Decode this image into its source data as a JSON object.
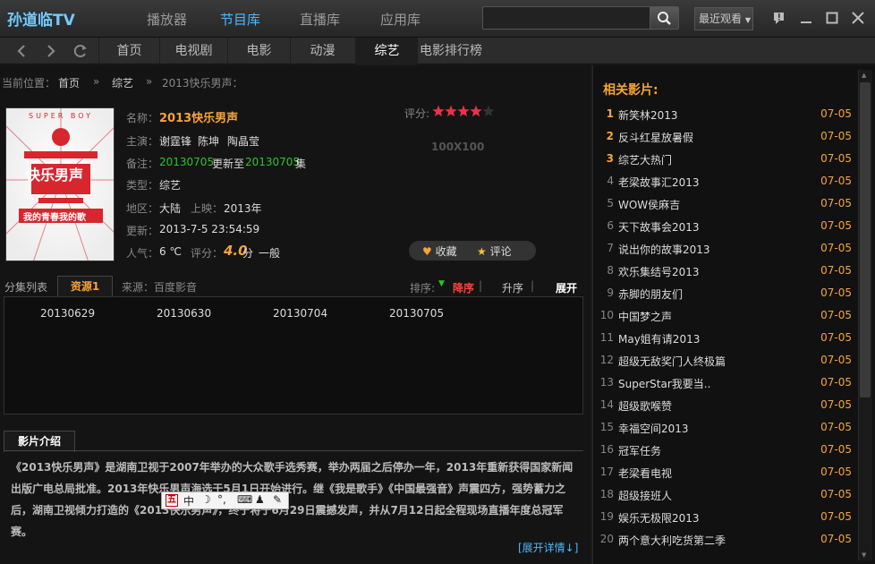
{
  "app": {
    "logo": "孙道临TV",
    "main_tabs": [
      "播放器",
      "节目库",
      "直播库",
      "应用库"
    ],
    "active_main_tab": 1,
    "search_placeholder": "",
    "recent_label": "最近观看"
  },
  "nav": {
    "tabs": [
      "首页",
      "电视剧",
      "电影",
      "动漫",
      "综艺",
      "电影排行榜"
    ],
    "active_tab": 4
  },
  "breadcrumb": {
    "prefix": "当前位置：",
    "items": [
      "首页",
      "综艺",
      "2013快乐男声："
    ],
    "separator": "»"
  },
  "detail": {
    "name_label": "名称：",
    "name": "2013快乐男声",
    "cast_label": "主演：",
    "cast": [
      "谢霆锋",
      "陈坤",
      "陶晶莹"
    ],
    "note_label": "备注：",
    "note_date1": "20130705",
    "note_mid": "更新至",
    "note_date2": "20130705",
    "note_suffix": "集",
    "type_label": "类型：",
    "type": "综艺",
    "region_label": "地区：",
    "region": "大陆",
    "release_label": "上映：",
    "release": "2013年",
    "updated_label": "更新：",
    "updated": "2013-7-5 23:54:59",
    "popularity_label": "人气：",
    "popularity": "6 ℃",
    "score_label": "评分：",
    "score": "4.0",
    "score_unit": "分",
    "score_desc": "一般",
    "rating_label": "评分:",
    "rating_stars": 4,
    "rating_max": 5,
    "ad_placeholder": "100X100",
    "favorite_label": "收藏",
    "comment_label": "评论"
  },
  "poster": {
    "text_main": "快乐男声",
    "text_sub": "我的青春我的歌",
    "text_top": "SUPER BOY"
  },
  "episodes": {
    "header_label": "分集列表",
    "source_tab": "资源1",
    "source_label": "来源：百度影音",
    "sort_label": "排序:",
    "sort_desc": "降序",
    "sort_asc": "升序",
    "expand": "展开",
    "items": [
      "20130629",
      "20130630",
      "20130704",
      "20130705"
    ]
  },
  "description": {
    "tab_label": "影片介绍",
    "text": "《2013快乐男声》是湖南卫视于2007年举办的大众歌手选秀赛，举办两届之后停办一年，2013年重新获得国家新闻出版广电总局批准。2013年快乐男声海选于5月1日开始进行。继《我是歌手》《中国最强音》声震四方，强势蓄力之后，湖南卫视倾力打造的《2013快乐男声》，终于将于6月29日震撼发声，并从7月12日起全程现场直播年度总冠军赛。",
    "more_link": "[展开详情↓]"
  },
  "ime": {
    "glyphs": [
      "五",
      "中",
      "☽",
      "°,",
      "⌨",
      "♟",
      "✎"
    ]
  },
  "related": {
    "title": "相关影片:",
    "items": [
      {
        "num": "1",
        "title": "新笑林2013",
        "date": "07-05"
      },
      {
        "num": "2",
        "title": "反斗红星放暑假",
        "date": "07-05"
      },
      {
        "num": "3",
        "title": "综艺大热门",
        "date": "07-05"
      },
      {
        "num": "4",
        "title": "老梁故事汇2013",
        "date": "07-05"
      },
      {
        "num": "5",
        "title": "WOW侯麻吉",
        "date": "07-05"
      },
      {
        "num": "6",
        "title": "天下故事会2013",
        "date": "07-05"
      },
      {
        "num": "7",
        "title": "说出你的故事2013",
        "date": "07-05"
      },
      {
        "num": "8",
        "title": "欢乐集结号2013",
        "date": "07-05"
      },
      {
        "num": "9",
        "title": "赤脚的朋友们",
        "date": "07-05"
      },
      {
        "num": "10",
        "title": "中国梦之声",
        "date": "07-05"
      },
      {
        "num": "11",
        "title": "May姐有请2013",
        "date": "07-05"
      },
      {
        "num": "12",
        "title": "超级无敌奖门人终极篇",
        "date": "07-05"
      },
      {
        "num": "13",
        "title": "SuperStar我要当..",
        "date": "07-05"
      },
      {
        "num": "14",
        "title": "超级歌喉赞",
        "date": "07-05"
      },
      {
        "num": "15",
        "title": "幸福空间2013",
        "date": "07-05"
      },
      {
        "num": "16",
        "title": "冠军任务",
        "date": "07-05"
      },
      {
        "num": "17",
        "title": "老梁看电视",
        "date": "07-05"
      },
      {
        "num": "18",
        "title": "超级接班人",
        "date": "07-05"
      },
      {
        "num": "19",
        "title": "娱乐无极限2013",
        "date": "07-05"
      },
      {
        "num": "20",
        "title": "两个意大利吃货第二季",
        "date": "07-05"
      }
    ]
  },
  "colors": {
    "accent_orange": "#f7a33a",
    "accent_blue": "#4db8ff",
    "note_green": "#2ec22e",
    "star_red": "#e8334a"
  }
}
